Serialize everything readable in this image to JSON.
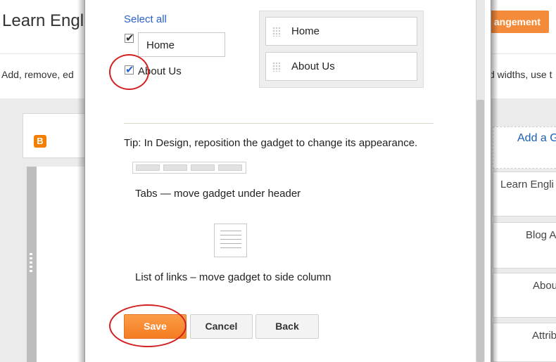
{
  "background": {
    "title": "Learn Engl",
    "action_button": "angement",
    "description_left": "Add, remove, ed",
    "description_right": "d widths, use t",
    "add_gadget": "Add a G",
    "gadgets": [
      "Learn Engli",
      "Blog A",
      "Abou",
      "Attrib"
    ],
    "accent_color": "#f48b3b"
  },
  "dialog": {
    "select_all": "Select all",
    "pages": [
      {
        "label": "Home",
        "checked": true
      },
      {
        "label": "About Us",
        "checked": true
      }
    ],
    "order": [
      "Home",
      "About Us"
    ],
    "tip": "Tip: In Design, reposition the gadget to change its appearance.",
    "tabs_caption": "Tabs — move gadget under header",
    "list_caption": "List of links – move gadget to side column",
    "buttons": {
      "save": "Save",
      "cancel": "Cancel",
      "back": "Back"
    },
    "link_color": "#2a62c9",
    "annotation_color": "#d42020"
  }
}
